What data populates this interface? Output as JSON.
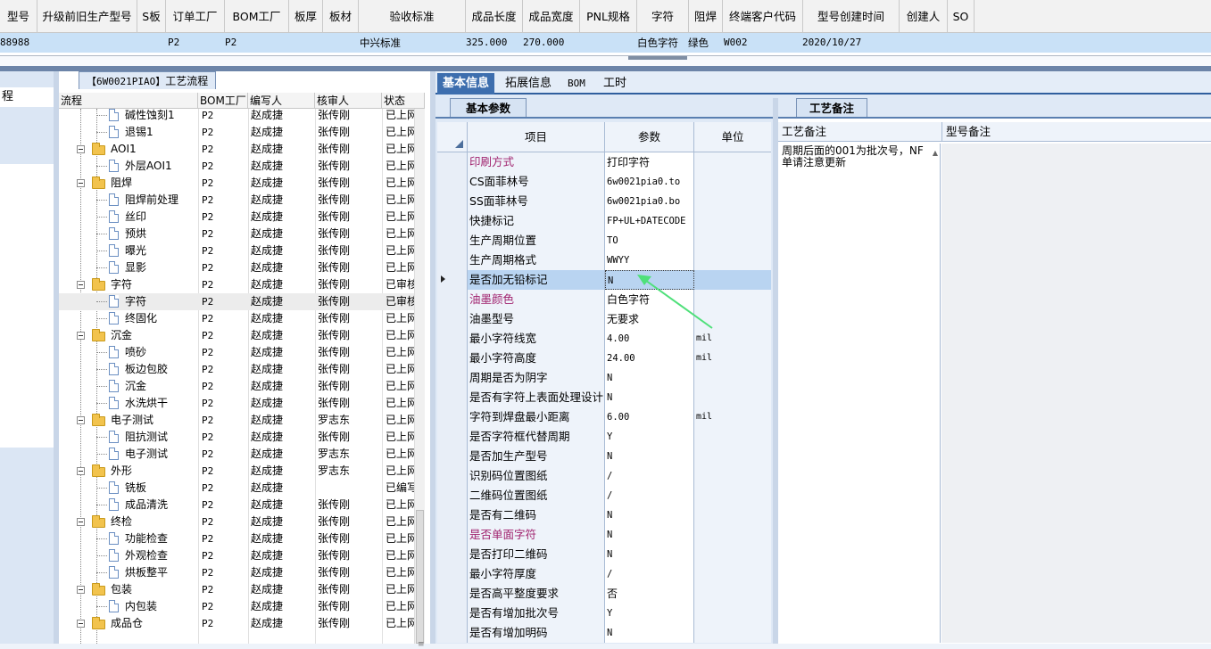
{
  "top_grid": {
    "headers": [
      "型号",
      "升级前旧生产型号",
      "S板",
      "订单工厂",
      "BOM工厂",
      "板厚",
      "板材",
      "验收标准",
      "成品长度",
      "成品宽度",
      "PNL规格",
      "字符",
      "阻焊",
      "终端客户代码",
      "型号创建时间",
      "创建人",
      "SO"
    ],
    "row": {
      "model": "88988",
      "order_factory": "P2",
      "bom_factory": "P2",
      "standard": "中兴标准",
      "length": "325.000",
      "width": "270.000",
      "char": "白色字符",
      "mask": "绿色",
      "customer_code": "W002",
      "created": "2020/10/27"
    }
  },
  "left_far": {
    "caption": "程"
  },
  "process": {
    "tab_code": "【6W0021PIAO】",
    "tab_label": "工艺流程",
    "headers": [
      "流程",
      "BOM工厂",
      "编写人",
      "核审人",
      "状态"
    ],
    "rows": [
      {
        "name": "碱性蚀刻1",
        "level": 2,
        "bom": "P2",
        "writer": "赵成捷",
        "reviewer": "张传刚",
        "status": "已上网"
      },
      {
        "name": "退锡1",
        "level": 2,
        "bom": "P2",
        "writer": "赵成捷",
        "reviewer": "张传刚",
        "status": "已上网"
      },
      {
        "name": "AOI1",
        "level": 1,
        "bom": "P2",
        "writer": "赵成捷",
        "reviewer": "张传刚",
        "status": "已上网"
      },
      {
        "name": "外层AOI1",
        "level": 2,
        "bom": "P2",
        "writer": "赵成捷",
        "reviewer": "张传刚",
        "status": "已上网"
      },
      {
        "name": "阻焊",
        "level": 1,
        "bom": "P2",
        "writer": "赵成捷",
        "reviewer": "张传刚",
        "status": "已上网"
      },
      {
        "name": "阻焊前处理",
        "level": 2,
        "bom": "P2",
        "writer": "赵成捷",
        "reviewer": "张传刚",
        "status": "已上网"
      },
      {
        "name": "丝印",
        "level": 2,
        "bom": "P2",
        "writer": "赵成捷",
        "reviewer": "张传刚",
        "status": "已上网"
      },
      {
        "name": "预烘",
        "level": 2,
        "bom": "P2",
        "writer": "赵成捷",
        "reviewer": "张传刚",
        "status": "已上网"
      },
      {
        "name": "曝光",
        "level": 2,
        "bom": "P2",
        "writer": "赵成捷",
        "reviewer": "张传刚",
        "status": "已上网"
      },
      {
        "name": "显影",
        "level": 2,
        "bom": "P2",
        "writer": "赵成捷",
        "reviewer": "张传刚",
        "status": "已上网"
      },
      {
        "name": "字符",
        "level": 1,
        "bom": "P2",
        "writer": "赵成捷",
        "reviewer": "张传刚",
        "status": "已审核"
      },
      {
        "name": "字符",
        "level": 2,
        "bom": "P2",
        "writer": "赵成捷",
        "reviewer": "张传刚",
        "status": "已审核",
        "selected": true
      },
      {
        "name": "终固化",
        "level": 2,
        "bom": "P2",
        "writer": "赵成捷",
        "reviewer": "张传刚",
        "status": "已上网"
      },
      {
        "name": "沉金",
        "level": 1,
        "bom": "P2",
        "writer": "赵成捷",
        "reviewer": "张传刚",
        "status": "已上网"
      },
      {
        "name": "喷砂",
        "level": 2,
        "bom": "P2",
        "writer": "赵成捷",
        "reviewer": "张传刚",
        "status": "已上网"
      },
      {
        "name": "板边包胶",
        "level": 2,
        "bom": "P2",
        "writer": "赵成捷",
        "reviewer": "张传刚",
        "status": "已上网"
      },
      {
        "name": "沉金",
        "level": 2,
        "bom": "P2",
        "writer": "赵成捷",
        "reviewer": "张传刚",
        "status": "已上网"
      },
      {
        "name": "水洗烘干",
        "level": 2,
        "bom": "P2",
        "writer": "赵成捷",
        "reviewer": "张传刚",
        "status": "已上网"
      },
      {
        "name": "电子测试",
        "level": 1,
        "bom": "P2",
        "writer": "赵成捷",
        "reviewer": "罗志东",
        "status": "已上网"
      },
      {
        "name": "阻抗测试",
        "level": 2,
        "bom": "P2",
        "writer": "赵成捷",
        "reviewer": "张传刚",
        "status": "已上网"
      },
      {
        "name": "电子测试",
        "level": 2,
        "bom": "P2",
        "writer": "赵成捷",
        "reviewer": "罗志东",
        "status": "已上网"
      },
      {
        "name": "外形",
        "level": 1,
        "bom": "P2",
        "writer": "赵成捷",
        "reviewer": "罗志东",
        "status": "已上网"
      },
      {
        "name": "铣板",
        "level": 2,
        "bom": "P2",
        "writer": "赵成捷",
        "reviewer": "",
        "status": "已编写"
      },
      {
        "name": "成品清洗",
        "level": 2,
        "bom": "P2",
        "writer": "赵成捷",
        "reviewer": "张传刚",
        "status": "已上网"
      },
      {
        "name": "终检",
        "level": 1,
        "bom": "P2",
        "writer": "赵成捷",
        "reviewer": "张传刚",
        "status": "已上网"
      },
      {
        "name": "功能检查",
        "level": 2,
        "bom": "P2",
        "writer": "赵成捷",
        "reviewer": "张传刚",
        "status": "已上网"
      },
      {
        "name": "外观检查",
        "level": 2,
        "bom": "P2",
        "writer": "赵成捷",
        "reviewer": "张传刚",
        "status": "已上网"
      },
      {
        "name": "烘板整平",
        "level": 2,
        "bom": "P2",
        "writer": "赵成捷",
        "reviewer": "张传刚",
        "status": "已上网"
      },
      {
        "name": "包装",
        "level": 1,
        "bom": "P2",
        "writer": "赵成捷",
        "reviewer": "张传刚",
        "status": "已上网"
      },
      {
        "name": "内包装",
        "level": 2,
        "bom": "P2",
        "writer": "赵成捷",
        "reviewer": "张传刚",
        "status": "已上网"
      },
      {
        "name": "成品仓",
        "level": 1,
        "bom": "P2",
        "writer": "赵成捷",
        "reviewer": "张传刚",
        "status": "已上网"
      }
    ]
  },
  "middle": {
    "tabs": [
      "基本信息",
      "拓展信息",
      "BOM",
      "工时"
    ],
    "active_tab": "基本信息",
    "sub_tab": "基本参数",
    "headers": [
      "项目",
      "参数",
      "单位"
    ],
    "params": [
      {
        "item": "印刷方式",
        "value": "打印字符",
        "unit": "",
        "purple": true
      },
      {
        "item": "CS面菲林号",
        "value": "6w0021pia0.to",
        "unit": "",
        "mono": true
      },
      {
        "item": "SS面菲林号",
        "value": "6w0021pia0.bo",
        "unit": "",
        "mono": true
      },
      {
        "item": "快捷标记",
        "value": "FP+UL+DATECODE",
        "unit": "",
        "mono": true
      },
      {
        "item": "生产周期位置",
        "value": "TO",
        "unit": "",
        "mono": true
      },
      {
        "item": "生产周期格式",
        "value": "WWYY",
        "unit": "",
        "mono": true
      },
      {
        "item": "是否加无铅标记",
        "value": "N",
        "unit": "",
        "mono": true,
        "selected": true
      },
      {
        "item": "油墨颜色",
        "value": "白色字符",
        "unit": "",
        "purple": true
      },
      {
        "item": "油墨型号",
        "value": "无要求",
        "unit": ""
      },
      {
        "item": "最小字符线宽",
        "value": "4.00",
        "unit": "mil",
        "mono": true
      },
      {
        "item": "最小字符高度",
        "value": "24.00",
        "unit": "mil",
        "mono": true
      },
      {
        "item": "周期是否为阴字",
        "value": "N",
        "unit": "",
        "mono": true
      },
      {
        "item": "是否有字符上表面处理设计",
        "value": "N",
        "unit": "",
        "mono": true
      },
      {
        "item": "字符到焊盘最小距离",
        "value": "6.00",
        "unit": "mil",
        "mono": true
      },
      {
        "item": "是否字符框代替周期",
        "value": "Y",
        "unit": "",
        "mono": true
      },
      {
        "item": "是否加生产型号",
        "value": "N",
        "unit": "",
        "mono": true
      },
      {
        "item": "识别码位置图纸",
        "value": "/",
        "unit": "",
        "mono": true
      },
      {
        "item": "二维码位置图纸",
        "value": "/",
        "unit": "",
        "mono": true
      },
      {
        "item": "是否有二维码",
        "value": "N",
        "unit": "",
        "mono": true
      },
      {
        "item": "是否单面字符",
        "value": "N",
        "unit": "",
        "mono": true,
        "purple": true
      },
      {
        "item": "是否打印二维码",
        "value": "N",
        "unit": "",
        "mono": true
      },
      {
        "item": "最小字符厚度",
        "value": "/",
        "unit": "",
        "mono": true
      },
      {
        "item": "是否高平整度要求",
        "value": "否",
        "unit": ""
      },
      {
        "item": "是否有增加批次号",
        "value": "Y",
        "unit": "",
        "mono": true
      },
      {
        "item": "是否有增加明码",
        "value": "N",
        "unit": "",
        "mono": true
      }
    ]
  },
  "craft": {
    "tab": "工艺备注",
    "headers": [
      "工艺备注",
      "型号备注"
    ],
    "note": "周期后面的001为批次号，NF单请注意更新"
  },
  "colors": {
    "accent": "#3d6eae",
    "selection": "#b9d4f1",
    "purple_label": "#a0226e",
    "pointer_arrow": "#4fe07a"
  }
}
